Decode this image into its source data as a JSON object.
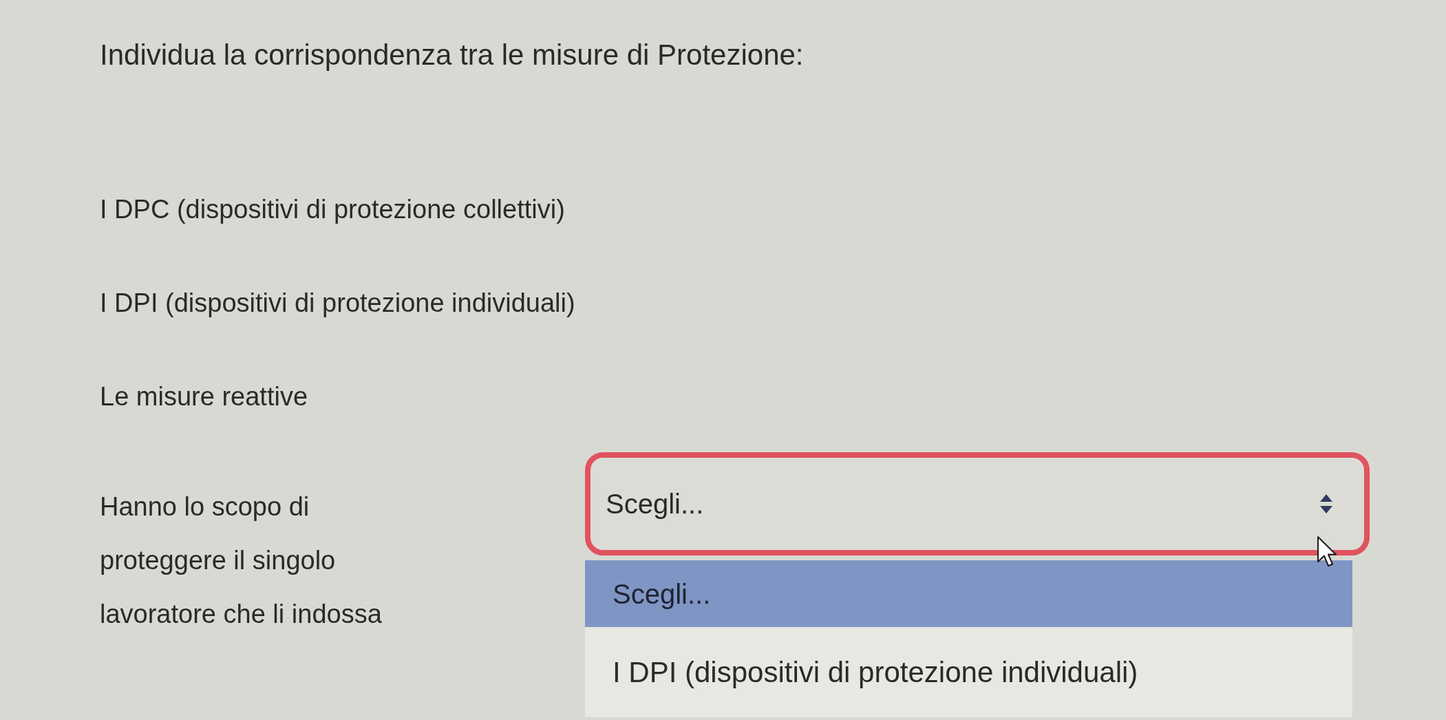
{
  "title": "Individua la corrispondenza tra le misure di Protezione:",
  "lines": [
    "I DPC (dispositivi di protezione collettivi)",
    "I DPI (dispositivi di protezione individuali)",
    "Le misure reattive"
  ],
  "rows": [
    {
      "stem_lines": [
        "Hanno lo scopo di",
        "proteggere il singolo",
        "lavoratore che li indossa"
      ],
      "select": {
        "value": "Scegli...",
        "focused": true,
        "open": true,
        "options": [
          {
            "label": "Scegli...",
            "selected": true
          },
          {
            "label": "I DPI (dispositivi di protezione individuali)",
            "selected": false
          }
        ]
      }
    }
  ]
}
